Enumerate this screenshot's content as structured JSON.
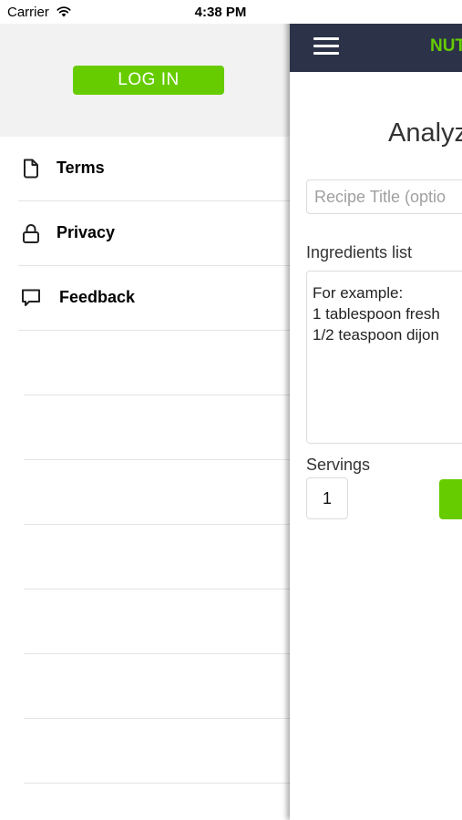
{
  "status_bar": {
    "carrier": "Carrier",
    "time": "4:38 PM"
  },
  "side_menu": {
    "login_label": "LOG IN",
    "items": [
      {
        "label": "Terms",
        "icon": "document-icon"
      },
      {
        "label": "Privacy",
        "icon": "lock-icon"
      },
      {
        "label": "Feedback",
        "icon": "speech-bubble-icon"
      }
    ]
  },
  "main": {
    "brand": "NUT",
    "heading": "Analyz",
    "title_placeholder": "Recipe Title (optio",
    "ingredients_label": "Ingredients list",
    "ingredients_placeholder_lines": [
      "For example:",
      "1 tablespoon fresh",
      "1/2 teaspoon dijon"
    ],
    "servings_label": "Servings",
    "servings_value": "1"
  },
  "colors": {
    "accent": "#66cc00",
    "nav_bar": "#2c3349",
    "menu_header_bg": "#f2f2f2"
  }
}
